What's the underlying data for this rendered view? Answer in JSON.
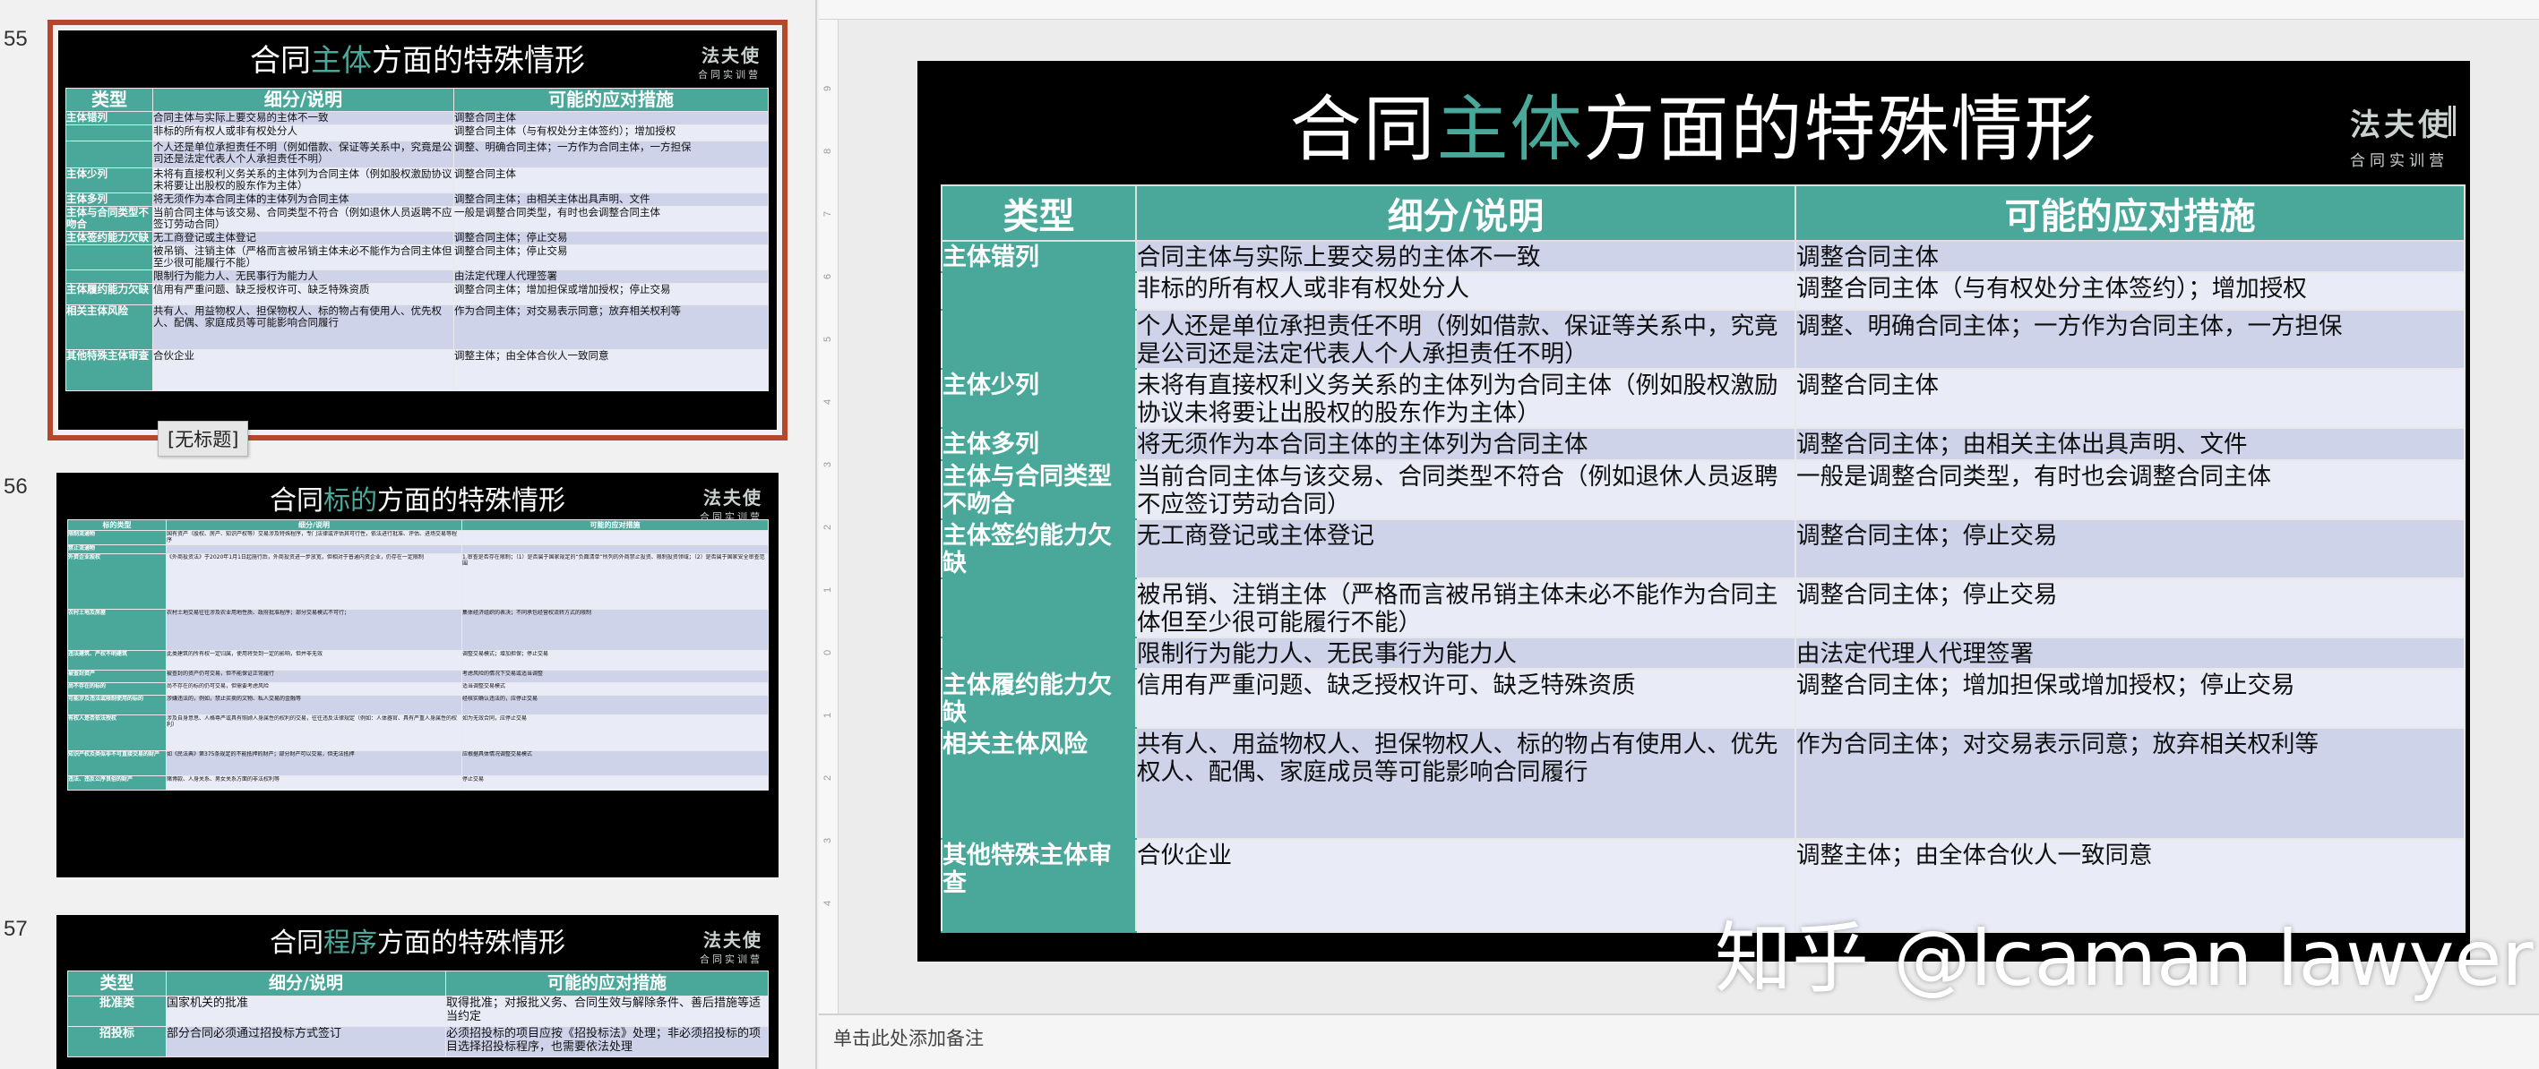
{
  "thumbnails": [
    {
      "number": "55",
      "selected": true,
      "title_prefix": "合同",
      "title_highlight": "主体",
      "title_suffix": "方面的特殊情形",
      "logo_line1": "法夫使",
      "logo_line2": "合同实训营",
      "caption": "[无标题]"
    },
    {
      "number": "56",
      "selected": false,
      "title_prefix": "合同",
      "title_highlight": "标的",
      "title_suffix": "方面的特殊情形",
      "logo_line1": "法夫使",
      "logo_line2": "合同实训营",
      "headers": [
        "标的类型",
        "细分/说明",
        "可能的应对措施"
      ],
      "rows": [
        [
          "限制流通物",
          "国有资产（股权、房产、知识产权等）交易涉及特殊程序，专门法律或评估其可行性，依法进行批准、评估、进场交易等程序",
          ""
        ],
        [
          "禁止流通物",
          "",
          ""
        ],
        [
          "外资企业股权",
          "《外商投资法》于2020年1月1日起施行后，外商投资进一步放宽，但相对于普通内资企业，仍存在一定限制",
          "1.审查是否存在限制；（1）是否属于国家规定的“负面清单”所列的外商禁止投资、限制投资领域；（2）是否属于国家安全审查范围"
        ],
        [
          "农村土地及房屋",
          "农村土地交易往往涉及农业用地性质、政府批准程序；部分交易模式不可行；",
          "集体经济组织的表决；不同承包经营权流转方式的限制"
        ],
        [
          "违法建筑、产权不明建筑",
          "此类建筑的所有权一定归属，使用将受到一定的影响，但并非无效",
          "调整交易模式；增加担保；停止交易"
        ],
        [
          "被查封资产",
          "被查封的资产仍可交易，但不能保证正常履行",
          "考虑风险的情况下交易或适当调整"
        ],
        [
          "尚不存在的标的",
          "尚不存在的标的仍可交易，但需要考虑风险",
          "适当调整交易模式"
        ],
        [
          "可能涉及违法或限制使用的标的",
          "涉嫌违法的，例如，禁止买卖的文物、私人交易的金融等",
          "经核实确认违法的，应停止交易"
        ],
        [
          "有权人是否依法授权",
          "涉及自身意思、人格尊严或具有照顾人身属性的权利的交易，往往违反法律规定（例如：人体器官、具有严重人身属性的权利）",
          "如为无效合同，应停止交易"
        ],
        [
          "知识产权及类似非不可直接交易的财产",
          "如《民法典》第375条规定的不能抵押的财产；部分财产可以交易，但无法抵押",
          "应根据具体情况调整交易模式"
        ],
        [
          "违法、违反公序良俗的财产",
          "赌博款、人身关系、男女关系方面的非法权利等",
          "停止交易"
        ]
      ]
    },
    {
      "number": "57",
      "selected": false,
      "title_prefix": "合同",
      "title_highlight": "程序",
      "title_suffix": "方面的特殊情形",
      "logo_line1": "法夫使",
      "logo_line2": "合同实训营",
      "headers": [
        "类型",
        "细分/说明",
        "可能的应对措施"
      ],
      "rows": [
        [
          "批准类",
          "国家机关的批准",
          "取得批准；对报批义务、合同生效与解除条件、善后措施等适当约定"
        ],
        [
          "招投标",
          "部分合同必须通过招投标方式签订",
          "必须招投标的项目应按《招投标法》处理；非必须招投标的项目选择招投标程序，也需要依法处理"
        ]
      ]
    }
  ],
  "slide": {
    "title_prefix": "合同",
    "title_highlight": "主体",
    "title_suffix": "方面的特殊情形",
    "logo_line1": "法夫使",
    "logo_line2": "合同实训营",
    "headers": [
      "类型",
      "细分/说明",
      "可能的应对措施"
    ],
    "rows": [
      {
        "type": "主体错列",
        "desc": "合同主体与实际上要交易的主体不一致",
        "measure": "调整合同主体",
        "shade": "b"
      },
      {
        "type": "",
        "desc": "非标的所有权人或非有权处分人",
        "measure": "调整合同主体（与有权处分主体签约）；增加授权",
        "shade": "w"
      },
      {
        "type": "",
        "desc": "个人还是单位承担责任不明（例如借款、保证等关系中，究竟是公司还是法定代表人个人承担责任不明）",
        "measure": "调整、明确合同主体；一方作为合同主体，一方担保",
        "shade": "b"
      },
      {
        "type": "主体少列",
        "desc": "未将有直接权利义务关系的主体列为合同主体（例如股权激励协议未将要让出股权的股东作为主体）",
        "measure": "调整合同主体",
        "shade": "w"
      },
      {
        "type": "主体多列",
        "desc": "将无须作为本合同主体的主体列为合同主体",
        "measure": "调整合同主体；由相关主体出具声明、文件",
        "shade": "b"
      },
      {
        "type": "主体与合同类型不吻合",
        "desc": "当前合同主体与该交易、合同类型不符合（例如退休人员返聘不应签订劳动合同）",
        "measure": "一般是调整合同类型，有时也会调整合同主体",
        "shade": "w"
      },
      {
        "type": "主体签约能力欠缺",
        "desc": "无工商登记或主体登记",
        "measure": "调整合同主体；停止交易",
        "shade": "b"
      },
      {
        "type": "",
        "desc": "被吊销、注销主体（严格而言被吊销主体未必不能作为合同主体但至少很可能履行不能）",
        "measure": "调整合同主体；停止交易",
        "shade": "w"
      },
      {
        "type": "",
        "desc": "限制行为能力人、无民事行为能力人",
        "measure": "由法定代理人代理签署",
        "shade": "b"
      },
      {
        "type": "主体履约能力欠缺",
        "desc": "信用有严重问题、缺乏授权许可、缺乏特殊资质",
        "measure": "调整合同主体；增加担保或增加授权；停止交易",
        "shade": "w"
      },
      {
        "type": "相关主体风险",
        "desc": "共有人、用益物权人、担保物权人、标的物占有使用人、优先权人、配偶、家庭成员等可能影响合同履行",
        "measure": "作为合同主体；对交易表示同意；放弃相关权利等",
        "shade": "b"
      },
      {
        "type": "其他特殊主体审查",
        "desc": "合伙企业",
        "measure": "调整主体；由全体合伙人一致同意",
        "shade": "w"
      }
    ]
  },
  "watermark": "知乎 @lcaman lawyer",
  "notes_placeholder": "单击此处添加备注",
  "colors": {
    "accent": "#4aa89a",
    "row_light": "#e9ebf7",
    "row_dark": "#cfd3ea",
    "selection_border": "#b7472a"
  }
}
